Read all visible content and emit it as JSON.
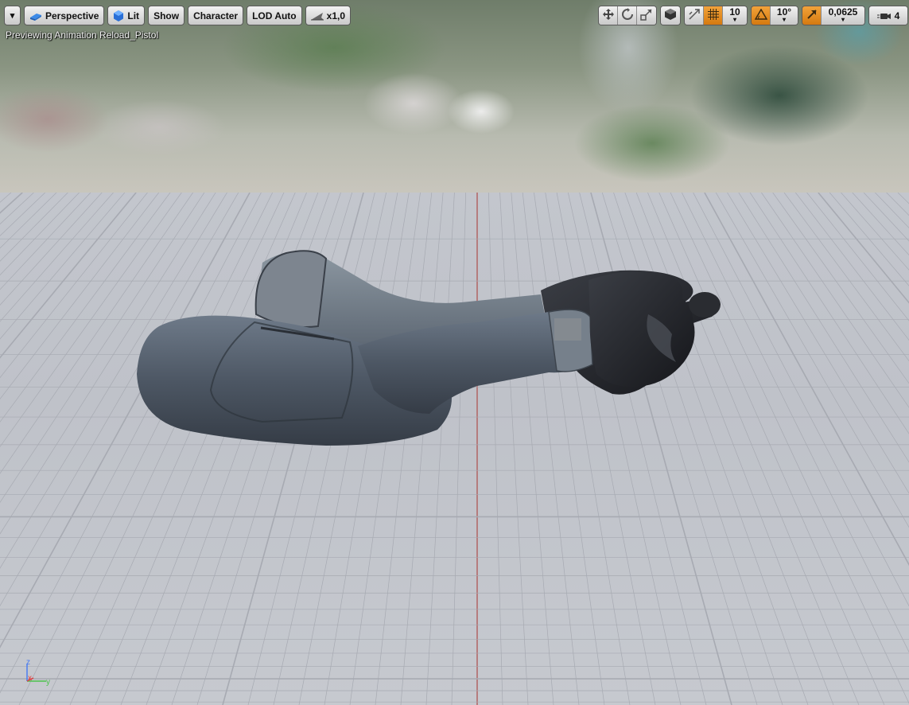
{
  "toolbar_left": {
    "menu_caret": "▾",
    "perspective_label": "Perspective",
    "lit_label": "Lit",
    "show_label": "Show",
    "character_label": "Character",
    "lod_label": "LOD Auto",
    "speed_label": "x1,0"
  },
  "toolbar_right": {
    "grid_snap_value": "10",
    "rotation_snap_value": "10°",
    "scale_snap_value": "0,0625",
    "camera_speed_value": "4"
  },
  "viewport": {
    "preview_text": "Previewing Animation Reload_Pistol"
  },
  "axis": {
    "z": "z",
    "x": "x",
    "y": "y"
  },
  "colors": {
    "accent_orange": "#e08a1e",
    "button_bg": "#d8d8d8",
    "grid_line": "#a7aab2",
    "grid_axis_red": "#b26a6a"
  },
  "icons": {
    "perspective": "perspective-cube-icon",
    "lit": "lit-sphere-icon",
    "speed": "play-speed-icon",
    "translate": "translate-arrows-icon",
    "rotate": "rotate-icon",
    "scale": "scale-icon",
    "surface": "surface-snap-icon",
    "snap_grid": "grid-snap-icon",
    "snap_rot": "rotation-snap-icon",
    "snap_scale": "scale-snap-icon",
    "camera": "camera-speed-icon"
  }
}
